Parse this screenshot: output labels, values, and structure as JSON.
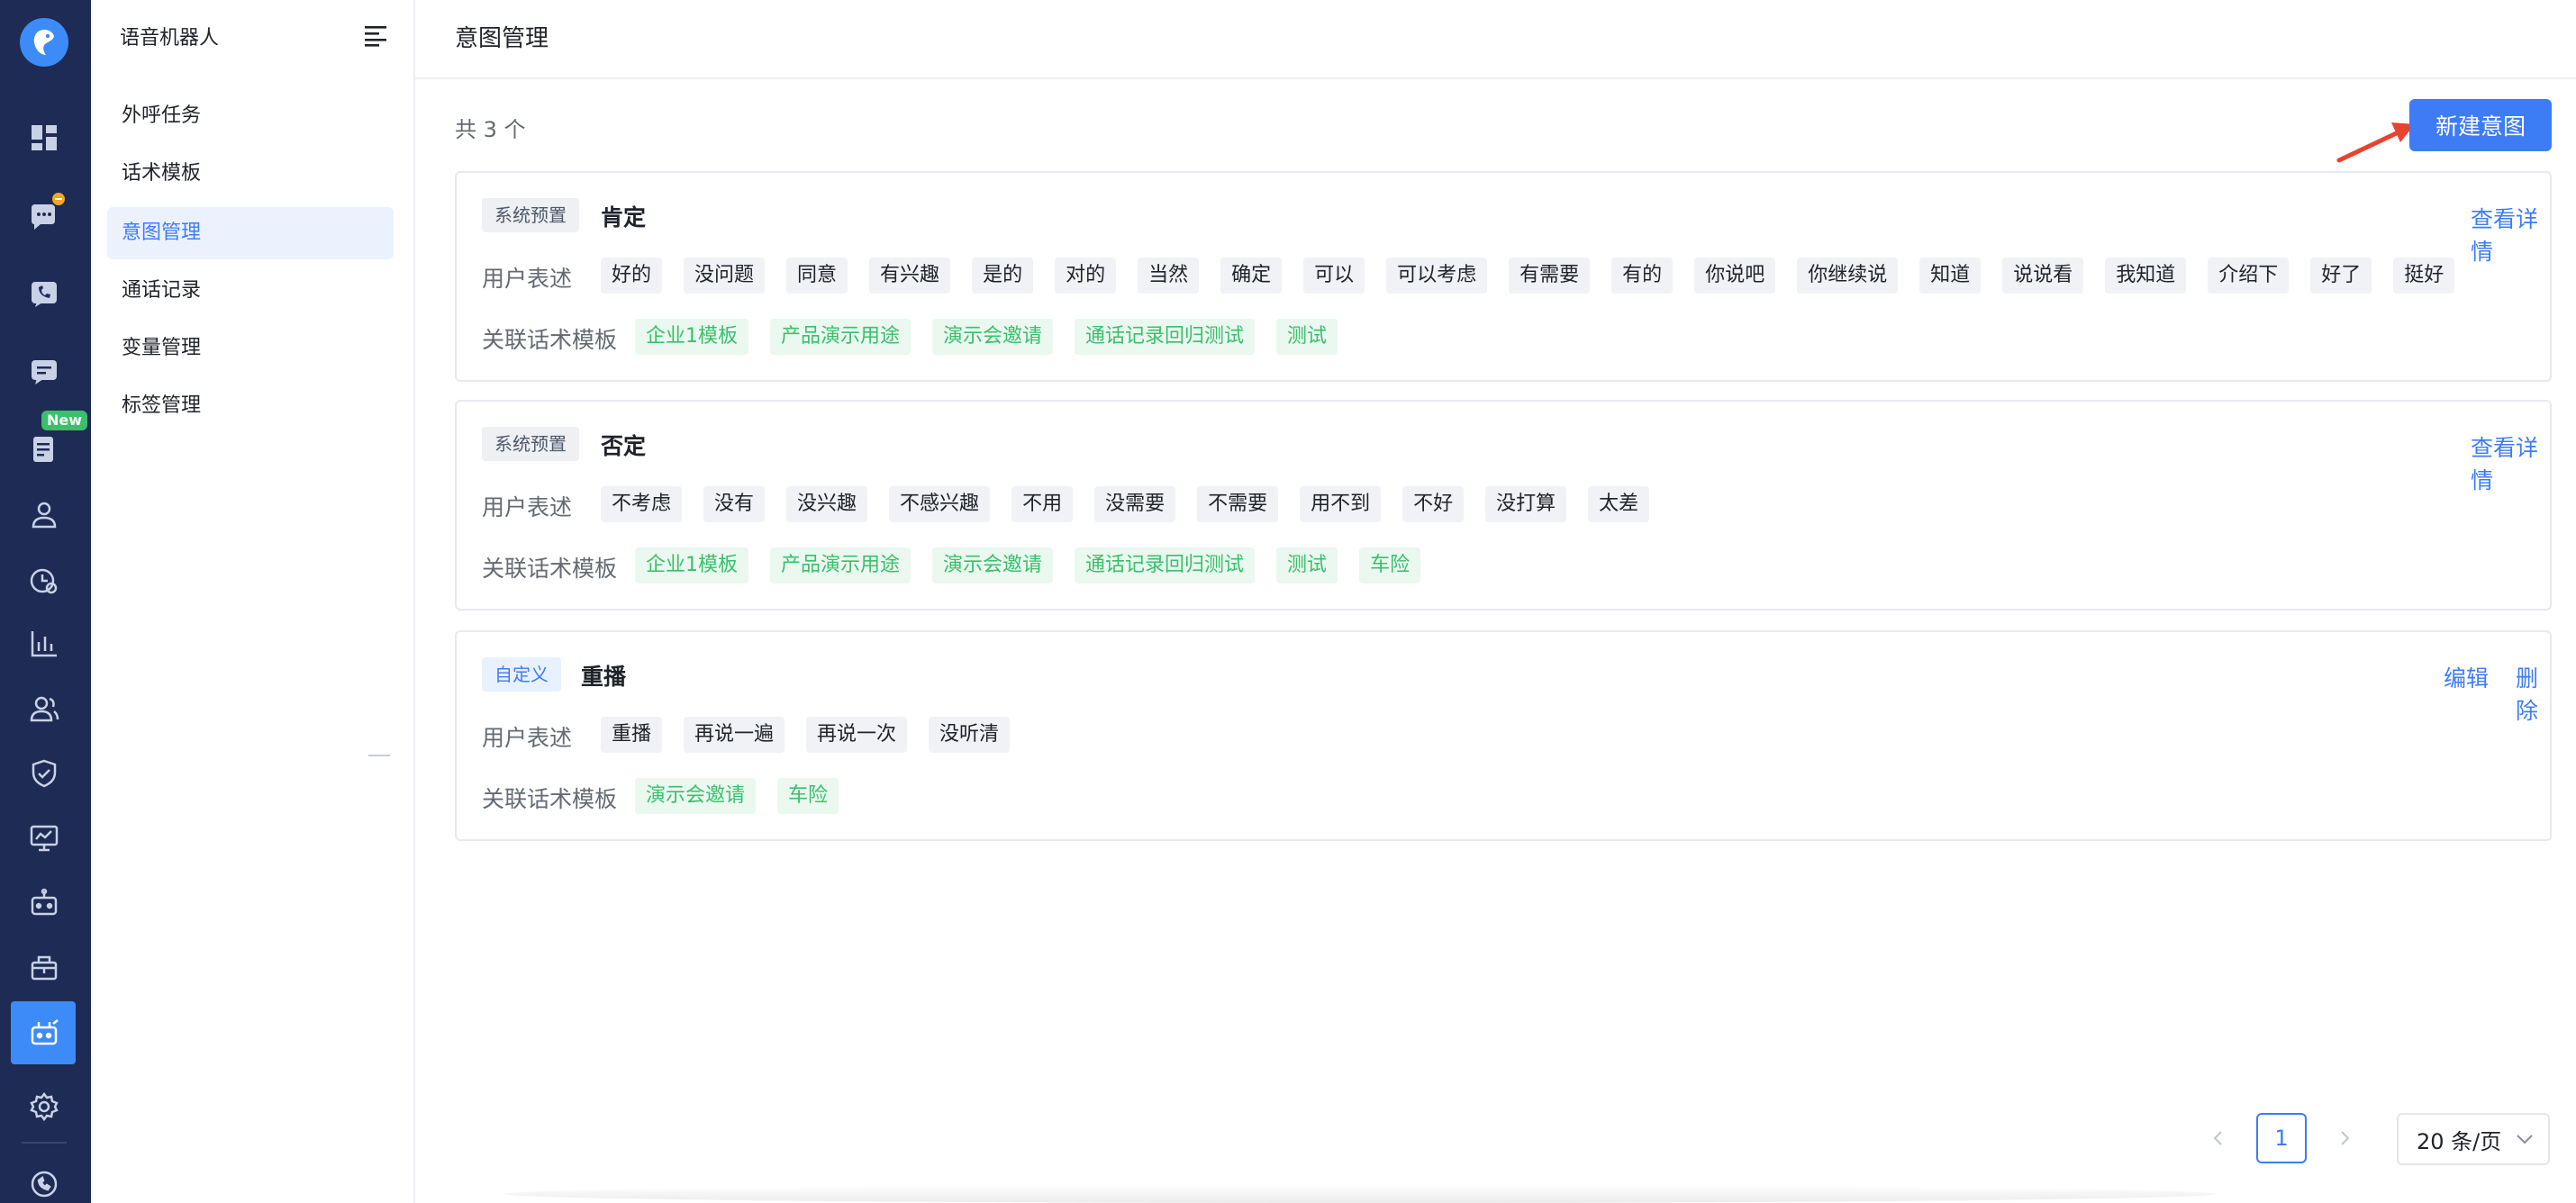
{
  "rail": {
    "items": [
      "dashboard-icon",
      "chat-icon",
      "phone-icon",
      "message-icon",
      "document-icon",
      "user-icon",
      "clock-icon",
      "bar-chart-icon",
      "users-icon",
      "shield-icon",
      "monitor-icon",
      "robot-icon",
      "package-icon",
      "robot-active-icon",
      "settings-icon",
      "support-icon"
    ],
    "new_badge": "New"
  },
  "sidebar": {
    "title": "语音机器人",
    "items": [
      {
        "label": "外呼任务"
      },
      {
        "label": "话术模板"
      },
      {
        "label": "意图管理"
      },
      {
        "label": "通话记录"
      },
      {
        "label": "变量管理"
      },
      {
        "label": "标签管理"
      }
    ],
    "active_index": 2
  },
  "header": {
    "title": "意图管理"
  },
  "summary": {
    "count_text": "共 3 个"
  },
  "toolbar": {
    "new_label": "新建意图"
  },
  "labels": {
    "user_expr": "用户表述",
    "related_tpl": "关联话术模板"
  },
  "intents": [
    {
      "badge": "系统预置",
      "name": "肯定",
      "actions": [
        "查看详情"
      ],
      "user_phrases": [
        "好的",
        "没问题",
        "同意",
        "有兴趣",
        "是的",
        "对的",
        "当然",
        "确定",
        "可以",
        "可以考虑",
        "有需要",
        "有的",
        "你说吧",
        "你继续说",
        "知道",
        "说说看",
        "我知道",
        "介绍下",
        "好了",
        "挺好"
      ],
      "templates": [
        "企业1模板",
        "产品演示用途",
        "演示会邀请",
        "通话记录回归测试",
        "测试"
      ]
    },
    {
      "badge": "系统预置",
      "name": "否定",
      "actions": [
        "查看详情"
      ],
      "user_phrases": [
        "不考虑",
        "没有",
        "没兴趣",
        "不感兴趣",
        "不用",
        "没需要",
        "不需要",
        "用不到",
        "不好",
        "没打算",
        "太差"
      ],
      "templates": [
        "企业1模板",
        "产品演示用途",
        "演示会邀请",
        "通话记录回归测试",
        "测试",
        "车险"
      ]
    },
    {
      "badge": "自定义",
      "name": "重播",
      "actions": [
        "编辑",
        "删除"
      ],
      "user_phrases": [
        "重播",
        "再说一遍",
        "再说一次",
        "没听清"
      ],
      "templates": [
        "演示会邀请",
        "车险"
      ]
    }
  ],
  "pagination": {
    "current": "1",
    "page_size": "20 条/页"
  },
  "colors": {
    "accent": "#3d7cf5",
    "rail_bg": "#1d2b55",
    "tag_green": "#3bbf6b",
    "arrow": "#e8432f"
  }
}
